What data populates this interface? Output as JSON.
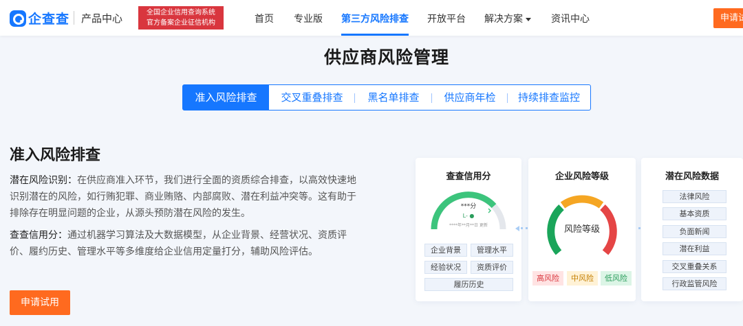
{
  "header": {
    "logo_text": "企查查",
    "product_center": "产品中心",
    "badge_line1": "全国企业信用查询系统",
    "badge_line2": "官方备案企业征信机构",
    "nav": [
      "首页",
      "专业版",
      "第三方风险排查",
      "开放平台",
      "解决方案",
      "资讯中心"
    ],
    "apply_label": "申请试用"
  },
  "page_title": "供应商风险管理",
  "tabs": [
    "准入风险排查",
    "交叉重叠排查",
    "黑名单排查",
    "供应商年检",
    "持续排查监控"
  ],
  "section": {
    "title": "准入风险排查",
    "para1_label": "潜在风险识别：",
    "para1_text": "在供应商准入环节，我们进行全面的资质综合排查，以高效快速地识别潜在的风险，如行贿犯罪、商业贿赂、内部腐败、潜在利益冲突等。这有助于排除存在明显问题的企业，从源头预防潜在风险的发生。",
    "para2_label": "查查信用分：",
    "para2_text": "通过机器学习算法及大数据模型，从企业背景、经营状况、资质评价、履约历史、管理水平等多维度给企业信用定量打分，辅助风险评估。",
    "apply_label": "申请试用"
  },
  "card1": {
    "title": "查查信用分",
    "gauge_score": "***分",
    "gauge_level": "L- ●",
    "gauge_date": "****年**月**日 更新",
    "chips": [
      "企业背景",
      "管理水平",
      "经验状况",
      "资质评价",
      "履历历史"
    ]
  },
  "card2": {
    "title": "企业风险等级",
    "gauge_label": "风险等级",
    "chips": [
      "高风险",
      "中风险",
      "低风险"
    ]
  },
  "card3": {
    "title": "潜在风险数据",
    "items": [
      "法律风险",
      "基本资质",
      "负面新闻",
      "潜在利益",
      "交叉重叠关系",
      "行政监管风险"
    ]
  },
  "colors": {
    "primary": "#1677ff",
    "orange": "#ff6a1f",
    "badge_red": "#d9363e",
    "gauge_green": "#1aa55a",
    "gauge_orange": "#f5a623",
    "gauge_red": "#e54545"
  }
}
